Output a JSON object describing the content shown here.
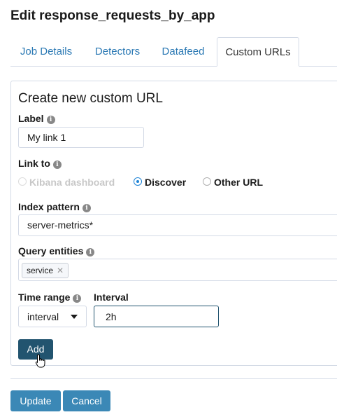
{
  "page": {
    "title": "Edit response_requests_by_app"
  },
  "tabs": [
    {
      "label": "Job Details"
    },
    {
      "label": "Detectors"
    },
    {
      "label": "Datafeed"
    },
    {
      "label": "Custom URLs"
    }
  ],
  "form": {
    "title": "Create new custom URL",
    "label_field": {
      "label": "Label",
      "value": "My link 1"
    },
    "link_to": {
      "label": "Link to",
      "options": [
        {
          "label": "Kibana dashboard",
          "state": "disabled"
        },
        {
          "label": "Discover",
          "state": "checked"
        },
        {
          "label": "Other URL",
          "state": "unchecked"
        }
      ]
    },
    "index_pattern": {
      "label": "Index pattern",
      "value": "server-metrics*"
    },
    "query_entities": {
      "label": "Query entities",
      "tags": [
        "service"
      ],
      "remove_glyph": "✕"
    },
    "time_range": {
      "label": "Time range",
      "value": "interval"
    },
    "interval": {
      "label": "Interval",
      "value": "2h"
    },
    "add_label": "Add"
  },
  "footer": {
    "update_label": "Update",
    "cancel_label": "Cancel"
  },
  "icons": {
    "info": "info-icon",
    "dropdown": "chevron-down-icon",
    "cursor": "pointer-hand-icon"
  },
  "colors": {
    "link": "#2b79b4",
    "primary_dark": "#22546f",
    "primary": "#3b88b6",
    "radio_checked": "#1f84d6",
    "input_focus": "#22546f"
  }
}
